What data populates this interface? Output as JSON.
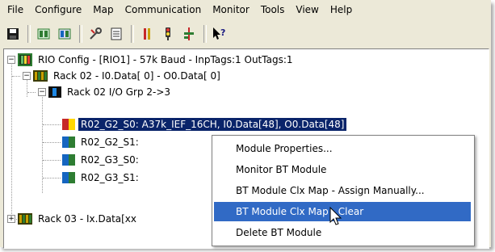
{
  "menubar": {
    "items": [
      "File",
      "Configure",
      "Map",
      "Communication",
      "Monitor",
      "Tools",
      "View",
      "Help"
    ]
  },
  "toolbar": {
    "buttons": [
      {
        "icon": "save-icon"
      },
      {
        "icon": "module-green-icon"
      },
      {
        "icon": "module-blue-icon"
      },
      {
        "icon": "tools-icon"
      },
      {
        "icon": "document-icon"
      },
      {
        "icon": "io-icon"
      },
      {
        "icon": "traffic-light-icon"
      },
      {
        "icon": "plug-icon"
      },
      {
        "icon": "help-pointer-icon"
      }
    ]
  },
  "tree": {
    "root": "RIO Config - [RIO1] -  57k Baud - InpTags:1 OutTags:1",
    "rack02": "Rack 02 - I0.Data[  0] - O0.Data[  0]",
    "group": "Rack 02 I/O Grp 2->3",
    "modules": [
      {
        "label": "R02_G2_S0:  A37k_IEF_16CH, I0.Data[48], O0.Data[48]",
        "color": "#ffd700"
      },
      {
        "label": "R02_G2_S1:",
        "color": "#2e7d32"
      },
      {
        "label": "R02_G3_S0:",
        "color": "#2e7d32"
      },
      {
        "label": "R02_G3_S1:",
        "color": "#2e7d32"
      }
    ],
    "rack03": "Rack 03 - Ix.Data[xx"
  },
  "context_menu": {
    "items": [
      "Module Properties...",
      "Monitor BT Module",
      "BT Module Clx Map - Assign Manually...",
      "BT Module Clx Map - Clear",
      "Delete BT Module"
    ],
    "highlighted_index": 3
  },
  "colors": {
    "selection": "#0a246a",
    "menu_highlight": "#316ac5",
    "chrome": "#ece9d8"
  }
}
